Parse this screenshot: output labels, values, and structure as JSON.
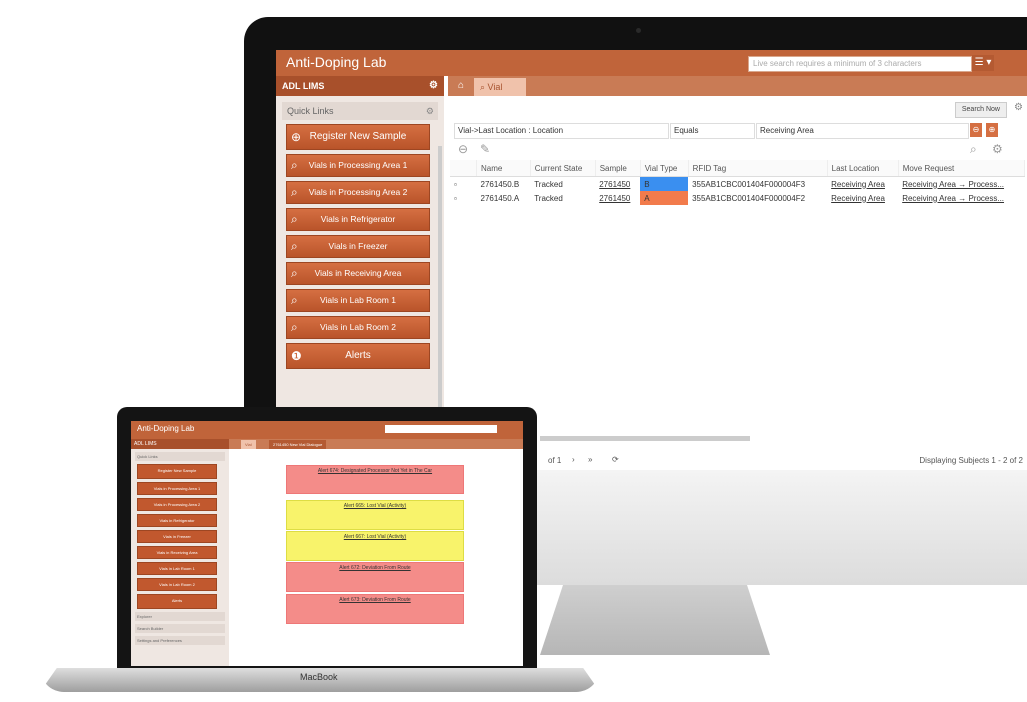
{
  "imac": {
    "app_title": "Anti-Doping Lab",
    "search_placeholder": "Live search requires a minimum of 3 characters",
    "menu_button": "☰ ▾",
    "sidebar": {
      "header": "ADL LIMS",
      "quick_links_label": "Quick Links",
      "items": [
        {
          "label": "Register New Sample",
          "icon": "plus-circle-icon"
        },
        {
          "label": "Vials in Processing Area 1",
          "icon": "search-icon"
        },
        {
          "label": "Vials in Processing Area 2",
          "icon": "search-icon"
        },
        {
          "label": "Vials in Refrigerator",
          "icon": "search-icon"
        },
        {
          "label": "Vials in Freezer",
          "icon": "search-icon"
        },
        {
          "label": "Vials in Receiving Area",
          "icon": "search-icon"
        },
        {
          "label": "Vials in Lab Room 1",
          "icon": "search-icon"
        },
        {
          "label": "Vials in Lab Room 2",
          "icon": "search-icon"
        },
        {
          "label": "Alerts",
          "icon": "alert-icon"
        }
      ]
    },
    "tab_label": "Vial",
    "search_now": "Search Now",
    "filter": {
      "field": "Vial->Last Location : Location",
      "operator": "Equals",
      "value": "Receiving Area"
    },
    "table": {
      "columns": [
        "Name",
        "Current State",
        "Sample",
        "Vial Type",
        "RFID Tag",
        "Last Location",
        "Move Request"
      ],
      "rows": [
        {
          "name": "2761450.B",
          "state": "Tracked",
          "sample": "2761450",
          "vial_type": "B",
          "rfid": "355AB1CBC001404F000004F3",
          "last_location": "Receiving Area",
          "move_request": "Receiving Area → Process..."
        },
        {
          "name": "2761450.A",
          "state": "Tracked",
          "sample": "2761450",
          "vial_type": "A",
          "rfid": "355AB1CBC001404F000004F2",
          "last_location": "Receiving Area",
          "move_request": "Receiving Area → Process..."
        }
      ]
    },
    "pager": {
      "page_text": "of 1",
      "display_text": "Displaying Subjects 1 - 2 of 2"
    }
  },
  "macbook": {
    "label": "MacBook",
    "app_title": "Anti-Doping Lab",
    "sidebar_header": "ADL LIMS",
    "quick_links_label": "Quick Links",
    "quick_links": [
      "Register New Sample",
      "Vials in Processing Area 1",
      "Vials in Processing Area 2",
      "Vials in Refrigerator",
      "Vials in Freezer",
      "Vials in Receiving Area",
      "Vials in Lab Room 1",
      "Vials in Lab Room 2",
      "Alerts"
    ],
    "footer_items": [
      "Explorer",
      "Search Builder",
      "Settings and Preferences"
    ],
    "tabs": [
      "Vial",
      "2761450 New Vial Dialogue"
    ],
    "alerts": [
      {
        "title": "Alert 674: Designated Processor Not Yet in The Car",
        "color": "red"
      },
      {
        "title": "Alert 665: Lost Vial (Activity)",
        "color": "yellow"
      },
      {
        "title": "Alert 667: Lost Vial (Activity)",
        "color": "yellow"
      },
      {
        "title": "Alert 672: Deviation From Route",
        "color": "red"
      },
      {
        "title": "Alert 673: Deviation From Route",
        "color": "red"
      }
    ]
  },
  "colors": {
    "primary": "#c0643a",
    "dark": "#a8502b",
    "vial_b": "#3a8ff0",
    "vial_a": "#f27b4c",
    "alert_red": "#f48c89",
    "alert_yellow": "#f8f36b"
  }
}
